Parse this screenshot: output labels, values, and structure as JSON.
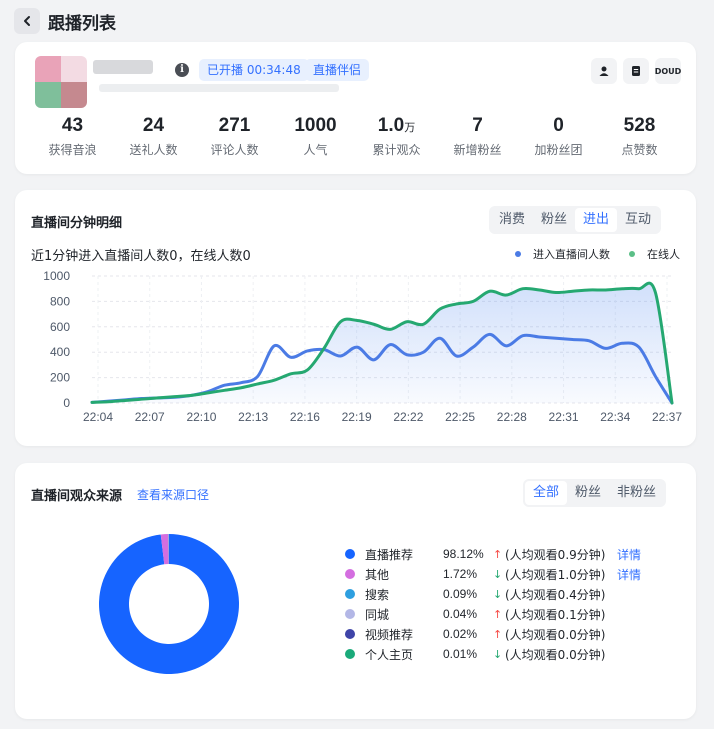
{
  "page": {
    "title": "跟播列表"
  },
  "header": {
    "status_tag": "已开播 00:34:48",
    "companion_tag": "直播伴侣",
    "info_icon": "info-icon",
    "tools": [
      {
        "icon": "person-icon"
      },
      {
        "icon": "document-icon"
      },
      {
        "icon": "douyin-logo-icon",
        "text": "DOUD"
      }
    ],
    "stats": [
      {
        "value": "43",
        "label": "获得音浪"
      },
      {
        "value": "24",
        "label": "送礼人数"
      },
      {
        "value": "271",
        "label": "评论人数"
      },
      {
        "value": "1000",
        "label": "人气"
      },
      {
        "value": "1.0",
        "unit": "万",
        "label": "累计观众"
      },
      {
        "value": "7",
        "label": "新增粉丝"
      },
      {
        "value": "0",
        "label": "加粉丝团"
      },
      {
        "value": "528",
        "label": "点赞数"
      }
    ]
  },
  "minute_detail": {
    "title": "直播间分钟明细",
    "tabs": [
      "消费",
      "粉丝",
      "进出",
      "互动"
    ],
    "active_tab": "进出",
    "subtitle": "近1分钟进入直播间人数0，在线人数0",
    "legend": [
      {
        "name": "进入直播间人数",
        "color": "#4b7be5"
      },
      {
        "name": "在线人",
        "color": "#3ab37a"
      }
    ]
  },
  "chart_data": {
    "type": "line",
    "x_ticks": [
      "22:04",
      "22:07",
      "22:10",
      "22:13",
      "22:16",
      "22:19",
      "22:22",
      "22:25",
      "22:28",
      "22:31",
      "22:34",
      "22:37"
    ],
    "y_ticks": [
      0,
      200,
      400,
      600,
      800,
      1000
    ],
    "ylim": [
      0,
      1000
    ],
    "xlim": [
      0,
      35
    ],
    "grid": true,
    "series": [
      {
        "name": "进入直播间人数",
        "color": "#4b7be5",
        "x": [
          0,
          1,
          2,
          3,
          4,
          5,
          6,
          7,
          8,
          9,
          10,
          11,
          12,
          13,
          14,
          15,
          16,
          17,
          18,
          19,
          20,
          21,
          22,
          23,
          24,
          25,
          26,
          27,
          28,
          29,
          30,
          31,
          32,
          33,
          34,
          35
        ],
        "values": [
          5,
          15,
          25,
          35,
          40,
          45,
          60,
          90,
          140,
          160,
          210,
          450,
          360,
          410,
          420,
          370,
          440,
          340,
          460,
          380,
          400,
          510,
          370,
          440,
          540,
          450,
          530,
          520,
          510,
          500,
          490,
          430,
          470,
          440,
          210,
          0
        ]
      },
      {
        "name": "在线人",
        "color": "#25a871",
        "x": [
          0,
          1,
          2,
          3,
          4,
          5,
          6,
          7,
          8,
          9,
          10,
          11,
          12,
          13,
          14,
          15,
          16,
          17,
          18,
          19,
          20,
          21,
          22,
          23,
          24,
          25,
          26,
          27,
          28,
          29,
          30,
          31,
          32,
          33,
          34,
          35
        ],
        "values": [
          5,
          10,
          20,
          30,
          40,
          50,
          60,
          80,
          100,
          120,
          150,
          180,
          230,
          260,
          430,
          640,
          650,
          620,
          580,
          640,
          620,
          740,
          780,
          800,
          880,
          850,
          900,
          890,
          870,
          880,
          890,
          890,
          900,
          900,
          870,
          0
        ]
      }
    ]
  },
  "audience_source": {
    "title": "直播间观众来源",
    "link": "查看来源口径",
    "tabs": [
      "全部",
      "粉丝",
      "非粉丝"
    ],
    "active_tab": "全部",
    "donut": [
      {
        "name": "直播推荐",
        "value": 98.12,
        "color": "#1664ff"
      },
      {
        "name": "其他",
        "value": 1.72,
        "color": "#d46ee0"
      },
      {
        "name": "搜索",
        "value": 0.09,
        "color": "#2e9fe0"
      },
      {
        "name": "同城",
        "value": 0.04,
        "color": "#b3b7e6"
      },
      {
        "name": "视频推荐",
        "value": 0.02,
        "color": "#3f44a8"
      },
      {
        "name": "个人主页",
        "value": 0.01,
        "color": "#1aaa7a"
      }
    ],
    "rows": [
      {
        "name": "直播推荐",
        "pct": "98.12%",
        "arrow": "↑",
        "avg": "(人均观看0.9分钟)",
        "detail": "详情"
      },
      {
        "name": "其他",
        "pct": "1.72%",
        "arrow": "↓",
        "avg": "(人均观看1.0分钟)",
        "detail": "详情"
      },
      {
        "name": "搜索",
        "pct": "0.09%",
        "arrow": "↓",
        "avg": "(人均观看0.4分钟)",
        "detail": ""
      },
      {
        "name": "同城",
        "pct": "0.04%",
        "arrow": "↑",
        "avg": "(人均观看0.1分钟)",
        "detail": ""
      },
      {
        "name": "视频推荐",
        "pct": "0.02%",
        "arrow": "↑",
        "avg": "(人均观看0.0分钟)",
        "detail": ""
      },
      {
        "name": "个人主页",
        "pct": "0.01%",
        "arrow": "↓",
        "avg": "(人均观看0.0分钟)",
        "detail": ""
      }
    ],
    "arrow_up_color": "#f54a45",
    "arrow_down_color": "#25a871"
  }
}
